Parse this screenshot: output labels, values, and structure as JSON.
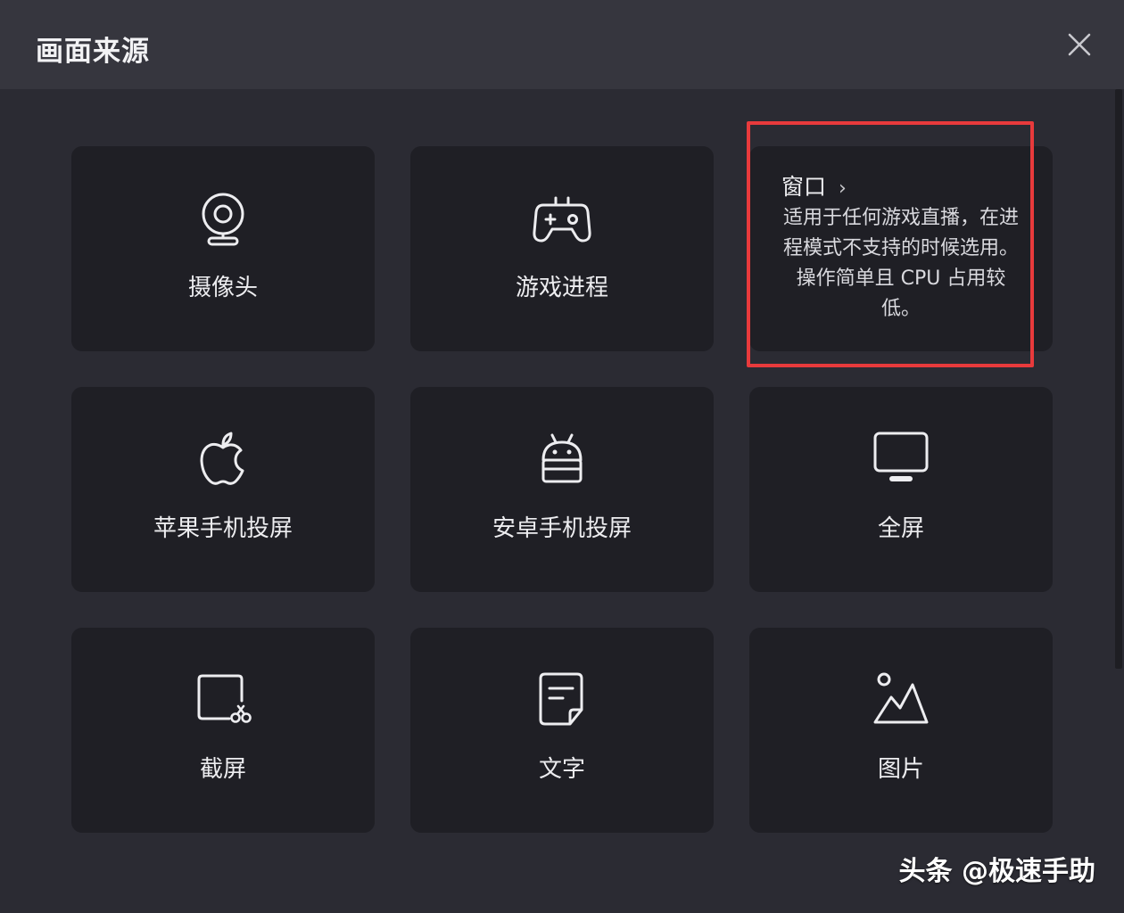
{
  "dialog": {
    "title": "画面来源",
    "close_icon": "close-icon"
  },
  "tiles": [
    {
      "label": "摄像头",
      "icon": "webcam-icon"
    },
    {
      "label": "游戏进程",
      "icon": "gamepad-icon"
    },
    {
      "label": "窗口",
      "icon": "chevron-right-icon",
      "description": "适用于任何游戏直播，在进程模式不支持的时候选用。操作简单且 CPU 占用较低。",
      "chevron": "›"
    },
    {
      "label": "苹果手机投屏",
      "icon": "apple-icon"
    },
    {
      "label": "安卓手机投屏",
      "icon": "android-icon"
    },
    {
      "label": "全屏",
      "icon": "monitor-icon"
    },
    {
      "label": "截屏",
      "icon": "screenshot-icon"
    },
    {
      "label": "文字",
      "icon": "text-document-icon"
    },
    {
      "label": "图片",
      "icon": "image-icon"
    }
  ],
  "watermark": "头条 @极速手助",
  "colors": {
    "background": "#2b2b33",
    "header": "#36363e",
    "tile": "#1f1f25",
    "highlight": "#e83a3c",
    "text": "#ededf0"
  }
}
